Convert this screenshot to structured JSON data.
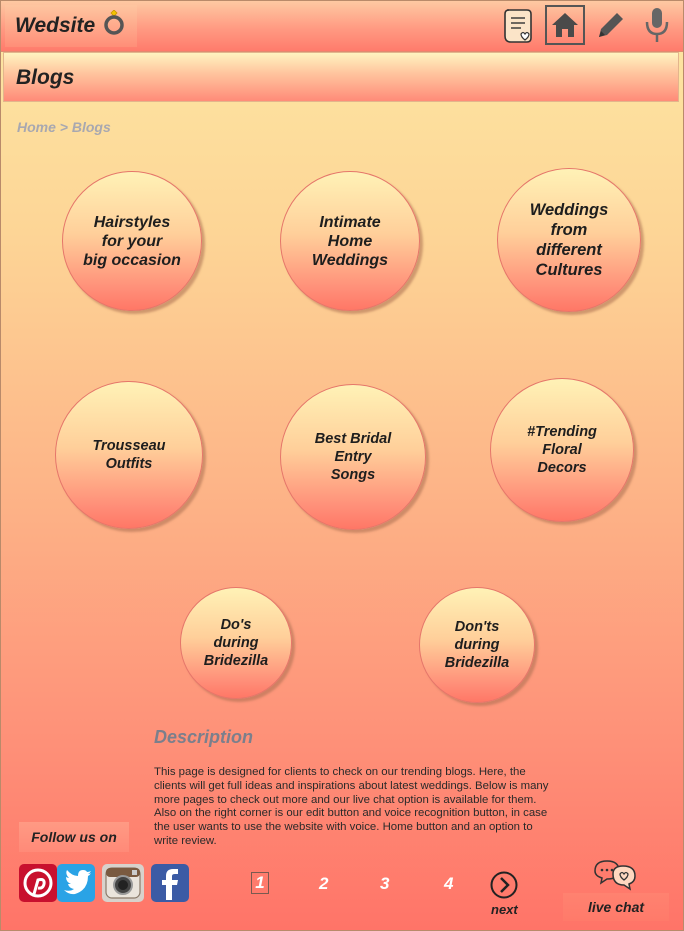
{
  "app": {
    "title": "Wedsite"
  },
  "page": {
    "title": "Blogs"
  },
  "breadcrumb": "Home > Blogs",
  "blogs": [
    {
      "label": "Hairstyles\nfor your\nbig occasion"
    },
    {
      "label": "Intimate\nHome\nWeddings"
    },
    {
      "label": "Weddings\nfrom\ndifferent\nCultures"
    },
    {
      "label": "Trousseau\nOutfits"
    },
    {
      "label": "Best Bridal\nEntry\nSongs"
    },
    {
      "label": "#Trending\nFloral\nDecors"
    },
    {
      "label": "Do's\nduring\nBridezilla"
    },
    {
      "label": "Don'ts\nduring\nBridezilla"
    }
  ],
  "description": {
    "title": "Description",
    "text": "This page is designed for clients to check on our trending blogs. Here, the clients will get full ideas and inspirations about latest weddings. Below is many more pages to check out more and our live chat option is available for them. Also on the right corner is our edit button and voice recognition button, in case the user wants to use the website with voice. Home button and an option to write review."
  },
  "footer": {
    "follow_label": "Follow us on",
    "pages": [
      "1",
      "2",
      "3",
      "4"
    ],
    "next_label": "next",
    "chat_label": "live chat"
  },
  "icons": {
    "brand": "ring-icon",
    "review": "review-scroll-icon",
    "home": "home-icon",
    "edit": "pencil-icon",
    "voice": "microphone-icon",
    "next": "chevron-right-circle-icon",
    "chat": "chat-bubbles-icon"
  },
  "colors": {
    "accent": "#ff7b6c",
    "background_top": "#fde8a4",
    "background_bottom": "#ff7468"
  }
}
